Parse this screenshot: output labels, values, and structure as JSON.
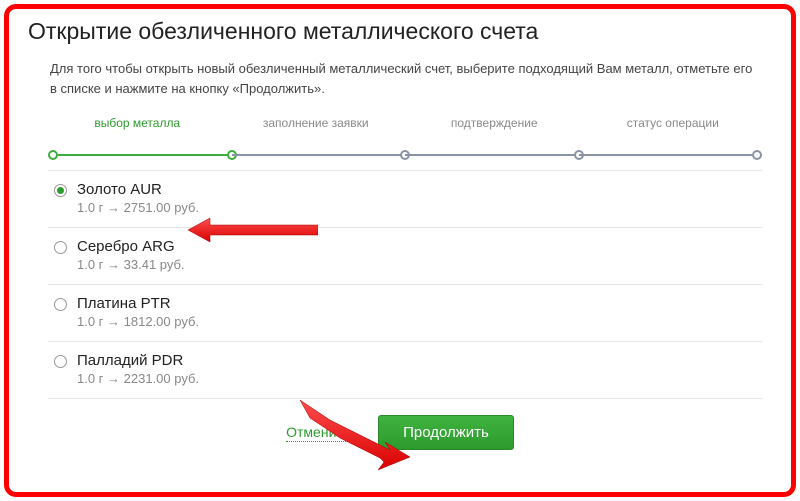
{
  "title": "Открытие обезличенного металлического счета",
  "intro": "Для того чтобы открыть новый обезличенный металлический счет, выберите подходящий Вам металл, отметьте его в списке и нажмите на кнопку «Продолжить».",
  "stepper": {
    "steps": [
      "выбор металла",
      "заполнение заявки",
      "подтверждение",
      "статус операции"
    ],
    "active_index": 0
  },
  "metals": [
    {
      "id": "aur",
      "label": "Золото AUR",
      "price": "1.0 г → 2751.00 руб.",
      "selected": true
    },
    {
      "id": "arg",
      "label": "Серебро ARG",
      "price": "1.0 г → 33.41 руб.",
      "selected": false
    },
    {
      "id": "ptr",
      "label": "Платина PTR",
      "price": "1.0 г → 1812.00 руб.",
      "selected": false
    },
    {
      "id": "pdr",
      "label": "Палладий PDR",
      "price": "1.0 г → 2231.00 руб.",
      "selected": false
    }
  ],
  "actions": {
    "cancel": "Отменить",
    "continue": "Продолжить"
  }
}
